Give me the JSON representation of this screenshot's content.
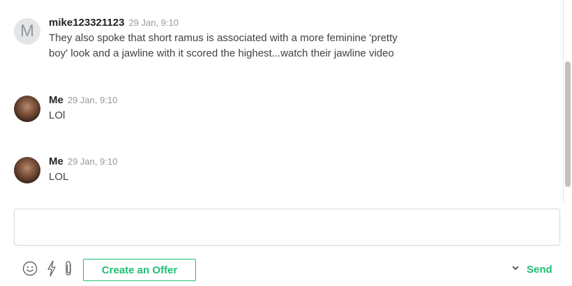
{
  "messages": [
    {
      "avatar_letter": "M",
      "sender": "mike123321123",
      "time": "29 Jan, 9:10",
      "lines": [
        "They also spoke that short ramus is associated with a more feminine 'pretty",
        "boy' look and a jawline with it scored the highest...watch their jawline video"
      ]
    },
    {
      "sender": "Me",
      "time": "29 Jan, 9:10",
      "lines": [
        "LOl"
      ]
    },
    {
      "sender": "Me",
      "time": "29 Jan, 9:10",
      "lines": [
        "LOL"
      ]
    }
  ],
  "composer": {
    "placeholder": ""
  },
  "toolbar": {
    "create_offer_label": "Create an Offer",
    "send_label": "Send",
    "icons": [
      "emoji-icon",
      "quick-response-icon",
      "attachment-icon",
      "chevron-down-icon"
    ]
  },
  "colors": {
    "accent": "#1dbf73",
    "text": "#404145",
    "muted": "#95979d"
  }
}
